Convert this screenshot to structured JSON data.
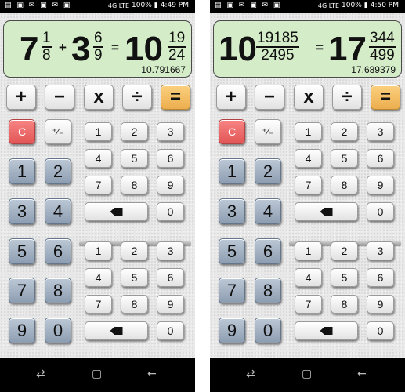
{
  "status_bar": {
    "left": {
      "time": "4:49 PM",
      "battery": "100%",
      "signal": "4G LTE"
    },
    "right": {
      "time": "4:50 PM",
      "battery": "100%",
      "signal": "4G LTE"
    }
  },
  "display": {
    "left": {
      "a_whole": "7",
      "a_num": "1",
      "a_den": "8",
      "op": "+",
      "b_whole": "3",
      "b_num": "6",
      "b_den": "9",
      "eq": "=",
      "r_whole": "10",
      "r_num": "19",
      "r_den": "24",
      "decimal": "10.791667"
    },
    "right": {
      "a_whole": "10",
      "a_num": "19185",
      "a_den": "2495",
      "eq": "=",
      "r_whole": "17",
      "r_num": "344",
      "r_den": "499",
      "decimal": "17.689379"
    }
  },
  "keys": {
    "plus": "+",
    "minus": "−",
    "times": "x",
    "divide": "÷",
    "equals": "=",
    "clear": "C",
    "plus_minus": "⁺∕₋",
    "d1": "1",
    "d2": "2",
    "d3": "3",
    "d4": "4",
    "d5": "5",
    "d6": "6",
    "d7": "7",
    "d8": "8",
    "d9": "9",
    "d0": "0"
  },
  "icons": {
    "status_left": [
      "message-icon",
      "image-icon",
      "email-icon",
      "photo-icon",
      "email-icon",
      "image-icon"
    ],
    "nav": [
      "recent-apps-icon",
      "home-icon",
      "back-icon"
    ]
  }
}
